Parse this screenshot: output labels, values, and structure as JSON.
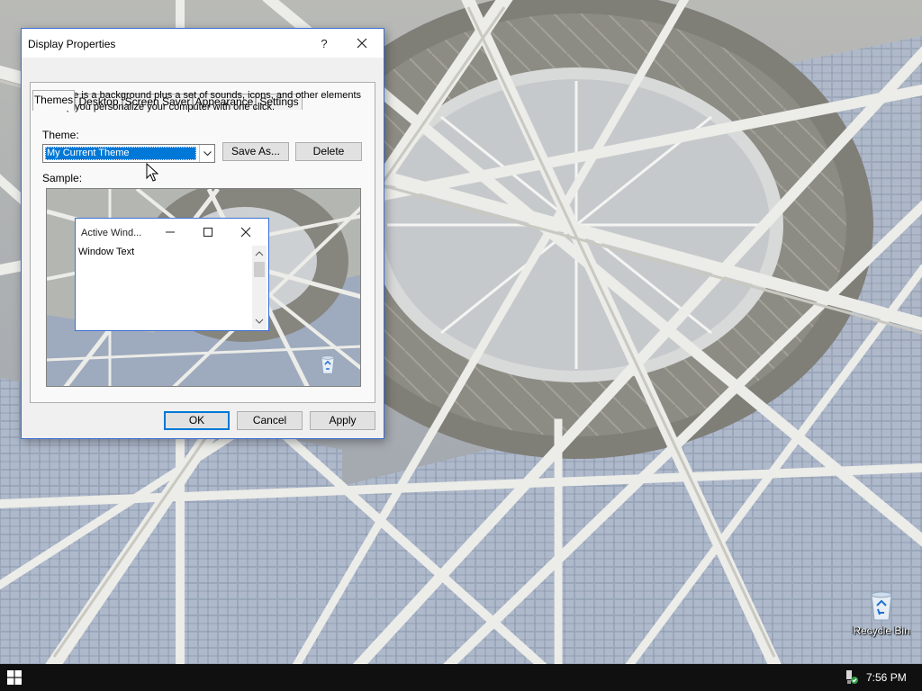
{
  "desktop": {
    "icons": [
      {
        "label": "Recycle Bin",
        "icon": "recycle-bin-icon"
      }
    ]
  },
  "taskbar": {
    "start_icon": "windows-logo-icon",
    "tray_icon": "network-security-icon",
    "clock": "7:56 PM"
  },
  "dialog": {
    "title": "Display Properties",
    "help_label": "?",
    "tabs": [
      {
        "label": "Themes",
        "active": true
      },
      {
        "label": "Desktop",
        "active": false
      },
      {
        "label": "Screen Saver",
        "active": false
      },
      {
        "label": "Appearance",
        "active": false
      },
      {
        "label": "Settings",
        "active": false
      }
    ],
    "themes": {
      "intro": "A theme is a background plus a set of sounds, icons, and other elements to help you personalize your computer with one click.",
      "theme_label": "Theme:",
      "theme_value": "My Current Theme",
      "save_as_label": "Save As...",
      "delete_label": "Delete",
      "sample_label": "Sample:",
      "sample_window": {
        "title": "Active Wind...",
        "text": "Window Text"
      }
    },
    "buttons": {
      "ok": "OK",
      "cancel": "Cancel",
      "apply": "Apply"
    }
  },
  "colors": {
    "accent": "#0078d7",
    "taskbar": "#101010",
    "window_border": "#3b6fd4",
    "dialog_bg": "#f0f0f0"
  }
}
